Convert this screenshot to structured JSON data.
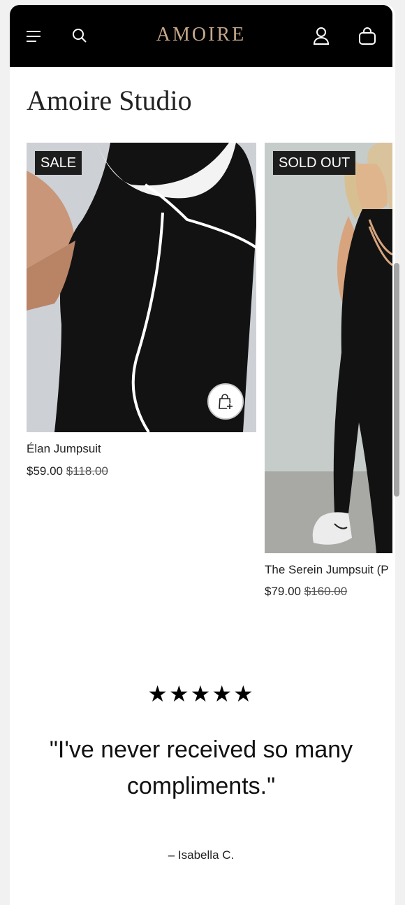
{
  "header": {
    "brand": "AMOIRE",
    "menu_icon": "menu-icon",
    "search_icon": "search-icon",
    "account_icon": "account-icon",
    "cart_icon": "bag-icon"
  },
  "collection": {
    "title": "Amoire Studio",
    "products": [
      {
        "badge": "SALE",
        "name": "Élan Jumpsuit",
        "price": "$59.00",
        "compare_price": "$118.00"
      },
      {
        "badge": "SOLD OUT",
        "name": "The Serein Jumpsuit (P",
        "price": "$79.00",
        "compare_price": "$160.00"
      }
    ]
  },
  "testimonial": {
    "stars": "★★★★★",
    "quote": "\"I've never received so many compliments.\"",
    "author": "– Isabella C."
  },
  "colors": {
    "header_bg": "#000000",
    "brand": "#c6a98a",
    "badge_bg": "#1d1d1d"
  }
}
